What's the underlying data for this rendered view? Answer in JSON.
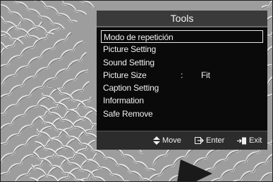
{
  "menu": {
    "title": "Tools",
    "items": [
      {
        "label": "Modo de repetición"
      },
      {
        "label": "Picture Setting"
      },
      {
        "label": "Sound Setting"
      },
      {
        "label": "Picture Size",
        "separator": ":",
        "value": "Fit"
      },
      {
        "label": "Caption Setting"
      },
      {
        "label": "Information"
      },
      {
        "label": "Safe Remove"
      }
    ],
    "selected_index": 0
  },
  "footer": {
    "move_label": "Move",
    "enter_label": "Enter",
    "exit_label": "Exit"
  },
  "icons": [
    "up-down-arrow-icon",
    "enter-icon",
    "exit-icon"
  ]
}
